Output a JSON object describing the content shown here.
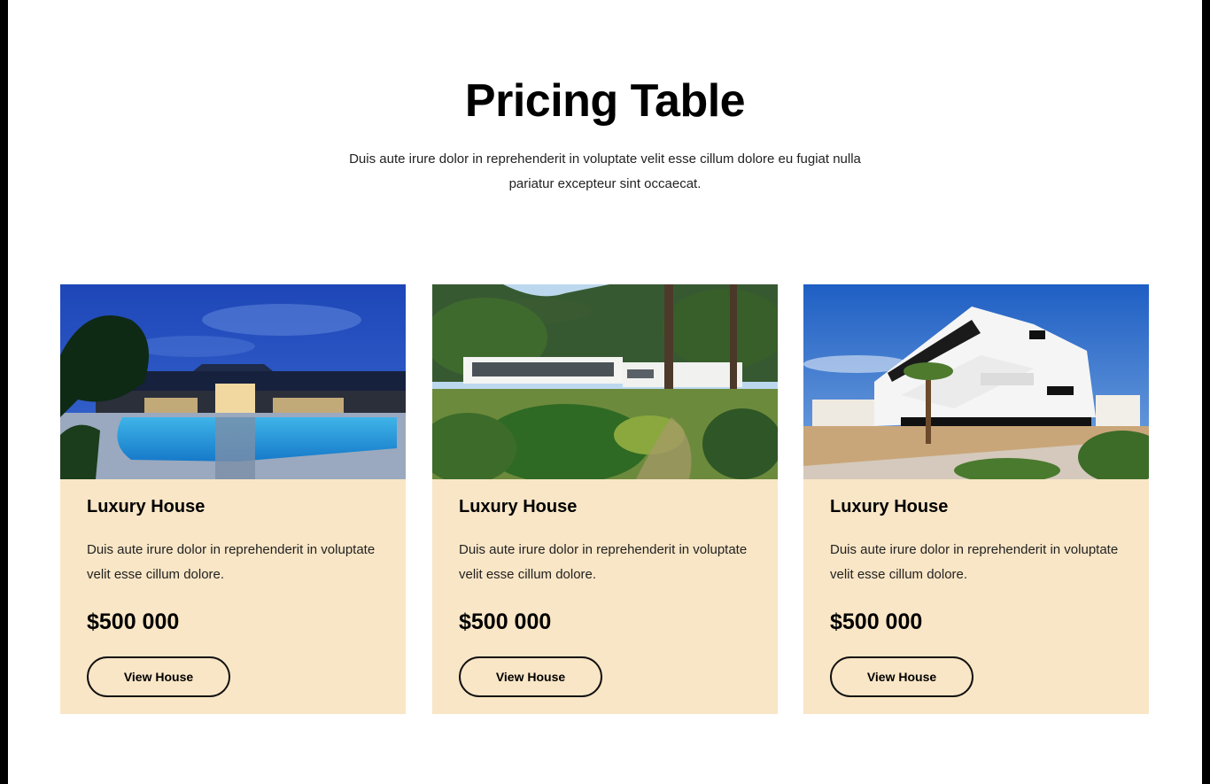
{
  "header": {
    "title": "Pricing Table",
    "subtitle": "Duis aute irure dolor in reprehenderit in voluptate velit esse cillum dolore eu fugiat nulla pariatur excepteur sint occaecat."
  },
  "cards": [
    {
      "image": "luxury-house-pool-night-image",
      "title": "Luxury House",
      "description": "Duis aute irure dolor in reprehenderit in voluptate velit esse cillum dolore.",
      "price": "$500 000",
      "button_label": "View House"
    },
    {
      "image": "modern-house-garden-image",
      "title": "Luxury House",
      "description": "Duis aute irure dolor in reprehenderit in voluptate velit esse cillum dolore.",
      "price": "$500 000",
      "button_label": "View House"
    },
    {
      "image": "white-apartment-building-image",
      "title": "Luxury House",
      "description": "Duis aute irure dolor in reprehenderit in voluptate velit esse cillum dolore.",
      "price": "$500 000",
      "button_label": "View House"
    }
  ],
  "colors": {
    "card_background": "#f9e6c6",
    "text": "#000000",
    "page_background": "#ffffff"
  }
}
